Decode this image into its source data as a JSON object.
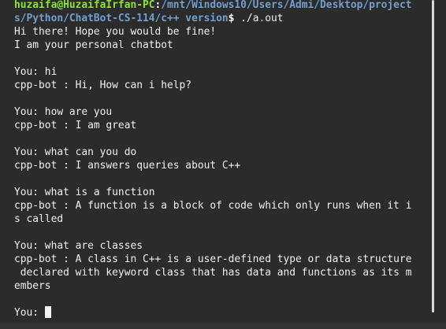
{
  "terminal": {
    "prompt": {
      "user_host": "huzaifa@HuzaifaIrfan-PC",
      "colon": ":",
      "path_line1": "/mnt/Windows10/Users/Admi/Desktop/project",
      "path_line2": "s/Python/ChatBot-CS-114/c++ version",
      "dollar": "$",
      "command": " ./a.out"
    },
    "lines": [
      "Hi there! Hope you would be fine!",
      "I am your personal chatbot",
      "",
      "You: hi",
      "cpp-bot : Hi, How can i help?",
      "",
      "You: how are you",
      "cpp-bot : I am great",
      "",
      "You: what can you do",
      "cpp-bot : I answers queries about C++",
      "",
      "You: what is a function",
      "cpp-bot : A function is a block of code which only runs when it i",
      "s called",
      "",
      "You: what are classes",
      "cpp-bot : A class in C++ is a user-defined type or data structure",
      " declared with keyword class that has data and functions as its m",
      "embers",
      ""
    ],
    "input_prompt": "You: "
  },
  "colors": {
    "background": "#2b2b2b",
    "text": "#f2f2f2",
    "prompt_user": "#8ae234",
    "prompt_path": "#729fcf"
  }
}
